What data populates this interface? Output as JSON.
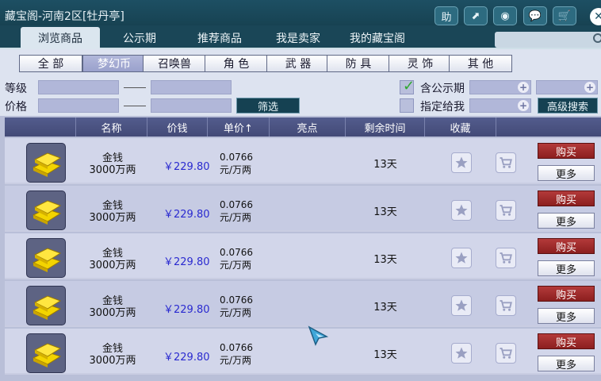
{
  "window": {
    "title": "藏宝阁-河南2区[牡丹亭]"
  },
  "toolbar": {
    "icons": [
      {
        "name": "help-icon",
        "glyph": "助"
      },
      {
        "name": "share-icon",
        "glyph": "⬈"
      },
      {
        "name": "record-icon",
        "glyph": "◉"
      },
      {
        "name": "chat-icon",
        "glyph": "💬"
      },
      {
        "name": "cart-icon",
        "glyph": "🛒"
      }
    ],
    "close_glyph": "✕"
  },
  "tabs": [
    {
      "label": "浏览商品",
      "active": true
    },
    {
      "label": "公示期",
      "active": false
    },
    {
      "label": "推荐商品",
      "active": false
    },
    {
      "label": "我是卖家",
      "active": false
    },
    {
      "label": "我的藏宝阁",
      "active": false
    }
  ],
  "categories": [
    {
      "label": "全 部",
      "active": false
    },
    {
      "label": "梦幻币",
      "active": true
    },
    {
      "label": "召唤兽",
      "active": false
    },
    {
      "label": "角 色",
      "active": false
    },
    {
      "label": "武 器",
      "active": false
    },
    {
      "label": "防 具",
      "active": false
    },
    {
      "label": "灵 饰",
      "active": false
    },
    {
      "label": "其 他",
      "active": false
    }
  ],
  "filters": {
    "level_label": "等级",
    "price_label": "价格",
    "filter_button": "筛选",
    "public_period_label": "含公示期",
    "public_period_checked": true,
    "assigned_label": "指定给我",
    "assigned_checked": false,
    "advanced_button": "高级搜索"
  },
  "table": {
    "headers": [
      "名称",
      "价钱",
      "单价↑",
      "亮点",
      "剩余时间",
      "收藏"
    ],
    "buy_label": "购买",
    "more_label": "更多",
    "rows": [
      {
        "name": "金钱",
        "amount": "3000万两",
        "price": "￥229.80",
        "unit_price": "0.0766",
        "unit": "元/万两",
        "remaining": "13天"
      },
      {
        "name": "金钱",
        "amount": "3000万两",
        "price": "￥229.80",
        "unit_price": "0.0766",
        "unit": "元/万两",
        "remaining": "13天"
      },
      {
        "name": "金钱",
        "amount": "3000万两",
        "price": "￥229.80",
        "unit_price": "0.0766",
        "unit": "元/万两",
        "remaining": "13天"
      },
      {
        "name": "金钱",
        "amount": "3000万两",
        "price": "￥229.80",
        "unit_price": "0.0766",
        "unit": "元/万两",
        "remaining": "13天"
      },
      {
        "name": "金钱",
        "amount": "3000万两",
        "price": "￥229.80",
        "unit_price": "0.0766",
        "unit": "元/万两",
        "remaining": "13天"
      }
    ]
  },
  "colors": {
    "accent": "#1d4f63",
    "buy": "#a32d2d",
    "price": "#2a2ad0"
  }
}
